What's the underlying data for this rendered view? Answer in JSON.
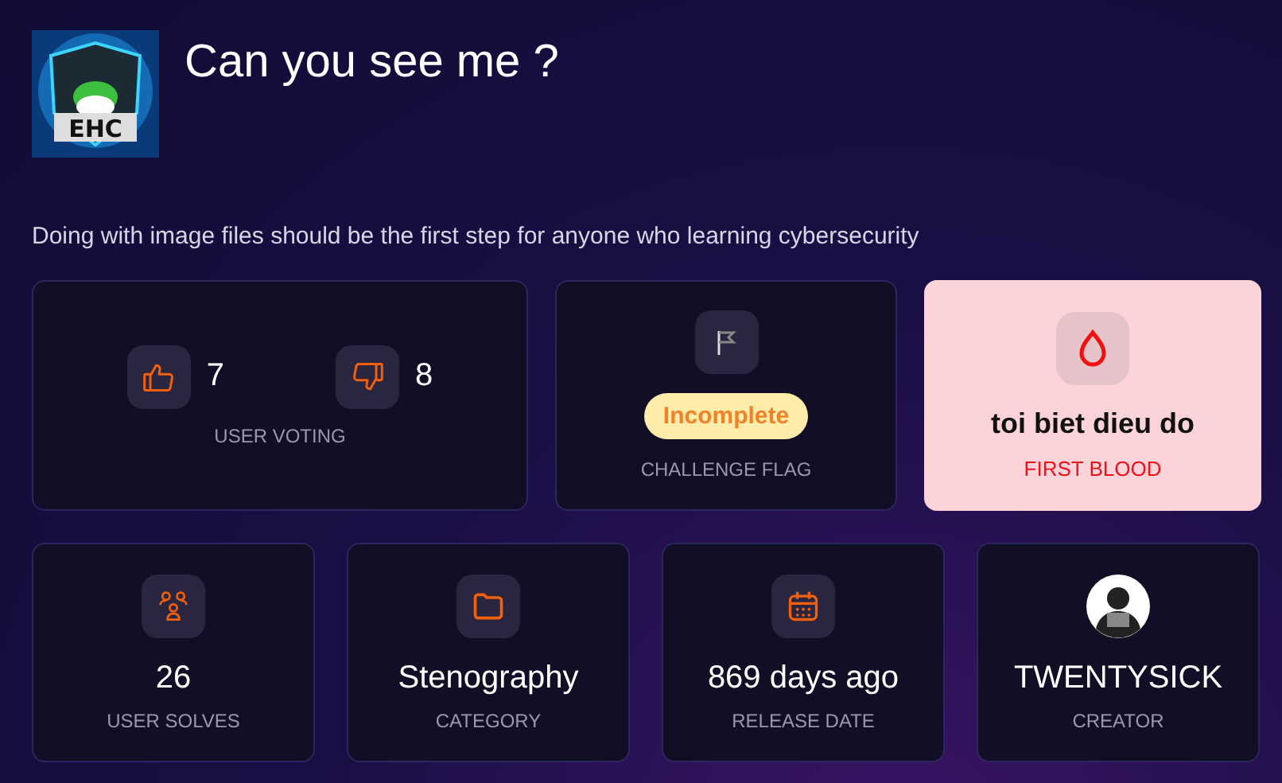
{
  "header": {
    "logo_text": "EHC",
    "title": "Can you see me ?",
    "description": "Doing with image files should be the first step for anyone who learning cybersecurity"
  },
  "voting": {
    "up": "7",
    "down": "8",
    "label": "USER VOTING"
  },
  "flag": {
    "status": "Incomplete",
    "label": "CHALLENGE FLAG"
  },
  "first_blood": {
    "name": "toi biet dieu do",
    "label": "FIRST BLOOD"
  },
  "stats": [
    {
      "kind": "solves",
      "value": "26",
      "label": "USER SOLVES"
    },
    {
      "kind": "category",
      "value": "Stenography",
      "label": "CATEGORY"
    },
    {
      "kind": "date",
      "value": "869 days ago",
      "label": "RELEASE DATE"
    },
    {
      "kind": "creator",
      "value": "TWENTYSICK",
      "label": "CREATOR"
    }
  ]
}
